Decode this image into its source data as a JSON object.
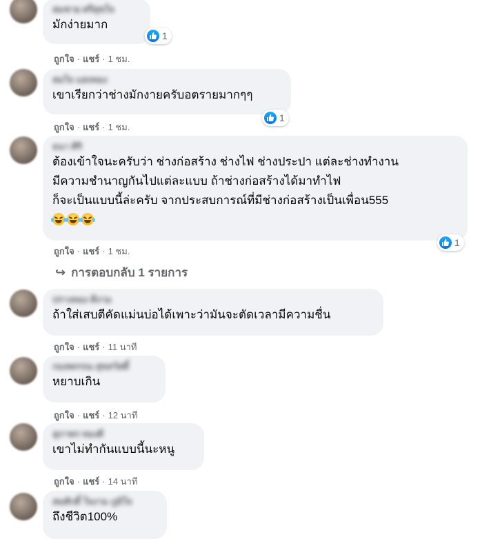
{
  "reactions": {
    "like_icon": "like-icon"
  },
  "actions": {
    "like": "ถูกใจ",
    "share": "แชร์",
    "separator": "·"
  },
  "comments": [
    {
      "name": "สมชาย ศรีสุขใจ",
      "text": "มักง่ายมาก",
      "reaction_count": "1",
      "time": "1 ชม."
    },
    {
      "name": "สมใจ แสงทอง",
      "text": "เขาเรียกว่าช่างมักงายครับอตรายมากๆๆ",
      "reaction_count": "1",
      "time": "1 ชม."
    },
    {
      "name": "ธนา ศิริ",
      "text": "ต้องเข้าใจนะครับว่า ช่างก่อสร้าง ช่างไฟ ช่างประปา แต่ละช่างทำงาน\nมีความชำนาญกันไปแต่ละแบบ ถ้าช่างก่อสร้างได้มาทำไฟ\nก็จะเป็นแบบนี้ล่ะครับ จากประสบการณ์ที่มีช่างก่อสร้างเป็นเพื่อน555",
      "reaction_count": "1",
      "time": "1 ชม."
    },
    {
      "name": "ปรางทอง ดีงาม",
      "text": "ถ้าใส่เสบตีคัดแม่นบ่อได้เพาะว่ามันจะตัดเวลามีความชื่น",
      "time": "11 นาที"
    },
    {
      "name": "กมลพรรณ สุขสวัสดิ์",
      "text": "หยาบเกิน",
      "time": "12 นาที"
    },
    {
      "name": "สุภาพร ทองดี",
      "text": "เขาไม่ทำกันแบบนี้นะหนู",
      "time": "14 นาที"
    },
    {
      "name": "สมศักดิ์ ใจงาม ภูมิใจ",
      "text": "ถึงชีวิต100%"
    }
  ],
  "replies": {
    "label": "การตอบกลับ 1 รายการ"
  }
}
